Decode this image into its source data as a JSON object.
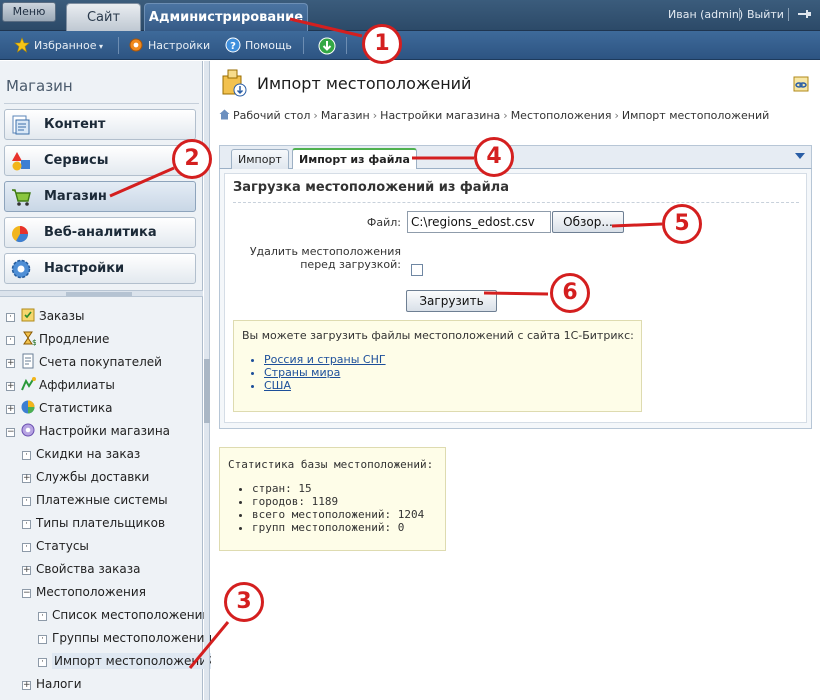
{
  "topbar": {
    "menu_label": "Меню",
    "tab_site": "Сайт",
    "tab_admin": "Администрирование",
    "user": "Иван (admin)",
    "logout": "Выйти"
  },
  "toolbar": {
    "favorites": "Избранное",
    "settings": "Настройки",
    "help": "Помощь"
  },
  "sidebar": {
    "title": "Магазин",
    "sections": [
      {
        "label": "Контент"
      },
      {
        "label": "Сервисы"
      },
      {
        "label": "Магазин"
      },
      {
        "label": "Веб-аналитика"
      },
      {
        "label": "Настройки"
      }
    ],
    "tree": [
      {
        "label": "Заказы"
      },
      {
        "label": "Продление"
      },
      {
        "label": "Счета покупателей"
      },
      {
        "label": "Аффилиаты"
      },
      {
        "label": "Статистика"
      },
      {
        "label": "Настройки магазина"
      },
      {
        "label": "Скидки на заказ"
      },
      {
        "label": "Службы доставки"
      },
      {
        "label": "Платежные системы"
      },
      {
        "label": "Типы плательщиков"
      },
      {
        "label": "Статусы"
      },
      {
        "label": "Свойства заказа"
      },
      {
        "label": "Местоположения"
      },
      {
        "label": "Список местоположений"
      },
      {
        "label": "Группы местоположений"
      },
      {
        "label": "Импорт местоположений"
      },
      {
        "label": "Налоги"
      }
    ]
  },
  "page": {
    "title": "Импорт местоположений",
    "breadcrumb": [
      "Рабочий стол",
      "Магазин",
      "Настройки магазина",
      "Местоположения",
      "Импорт местоположений"
    ],
    "tabs": [
      {
        "label": "Импорт"
      },
      {
        "label": "Импорт из файла"
      }
    ],
    "form_title": "Загрузка местоположений из файла",
    "file_label": "Файл:",
    "file_value": "C:\\regions_edost.csv",
    "browse_label": "Обзор...",
    "delete_label_1": "Удалить местоположения",
    "delete_label_2": "перед загрузкой:",
    "upload_label": "Загрузить",
    "note_text": "Вы можете загрузить файлы местоположений с сайта 1С-Битрикс:",
    "note_links": [
      "Россия и страны СНГ",
      "Страны мира",
      "США"
    ],
    "stats_title": "Статистика базы местоположений:",
    "stats_items": [
      "стран: 15",
      "городов: 1189",
      "всего местоположений: 1204",
      "групп местоположений: 0"
    ]
  },
  "callouts": [
    "1",
    "2",
    "3",
    "4",
    "5",
    "6"
  ],
  "colors": {
    "accent": "#d41f1f",
    "header": "#2d5482",
    "active_tab_line": "#4fb14f"
  }
}
